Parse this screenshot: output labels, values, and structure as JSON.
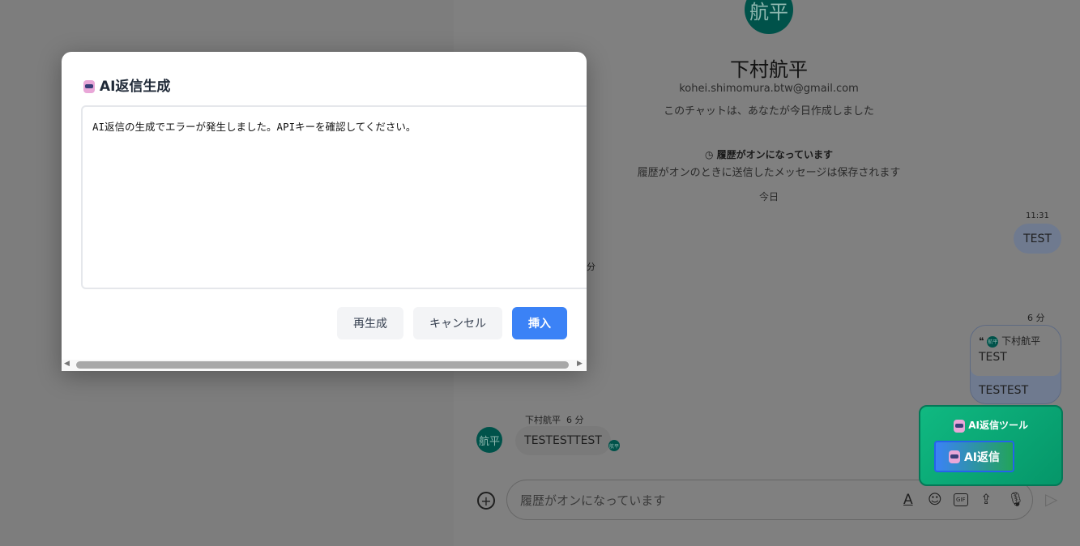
{
  "contact": {
    "avatar_text": "航平",
    "name": "下村航平",
    "email": "kohei.shimomura.btw@gmail.com",
    "created_note": "このチャットは、あなたが今日作成しました"
  },
  "history": {
    "title": "履歴がオンになっています",
    "subtitle": "履歴がオンのときに送信したメッセージは保存されます"
  },
  "date_divider": "今日",
  "messages": [
    {
      "time": "11:31",
      "text": "TEST"
    },
    {
      "time_partial": "分"
    },
    {
      "time": "6 分",
      "quote_author": "下村航平",
      "quote_text": "TEST",
      "text": "TESTEST"
    },
    {
      "sender": "下村航平",
      "time": "6 分",
      "text": "TESTESTTEST",
      "avatar_text": "航平"
    }
  ],
  "composer": {
    "placeholder": "履歴がオンになっています"
  },
  "dialog": {
    "title": "AI返信生成",
    "textarea_value": "AI返信の生成でエラーが発生しました。APIキーを確認してください。",
    "regenerate": "再生成",
    "cancel": "キャンセル",
    "insert": "挿入"
  },
  "ai_tool": {
    "title": "AI返信ツール",
    "button": "AI返信"
  },
  "colors": {
    "accent": "#3b82f6",
    "tool_panel": "#0ea472",
    "avatar": "#00524a"
  }
}
